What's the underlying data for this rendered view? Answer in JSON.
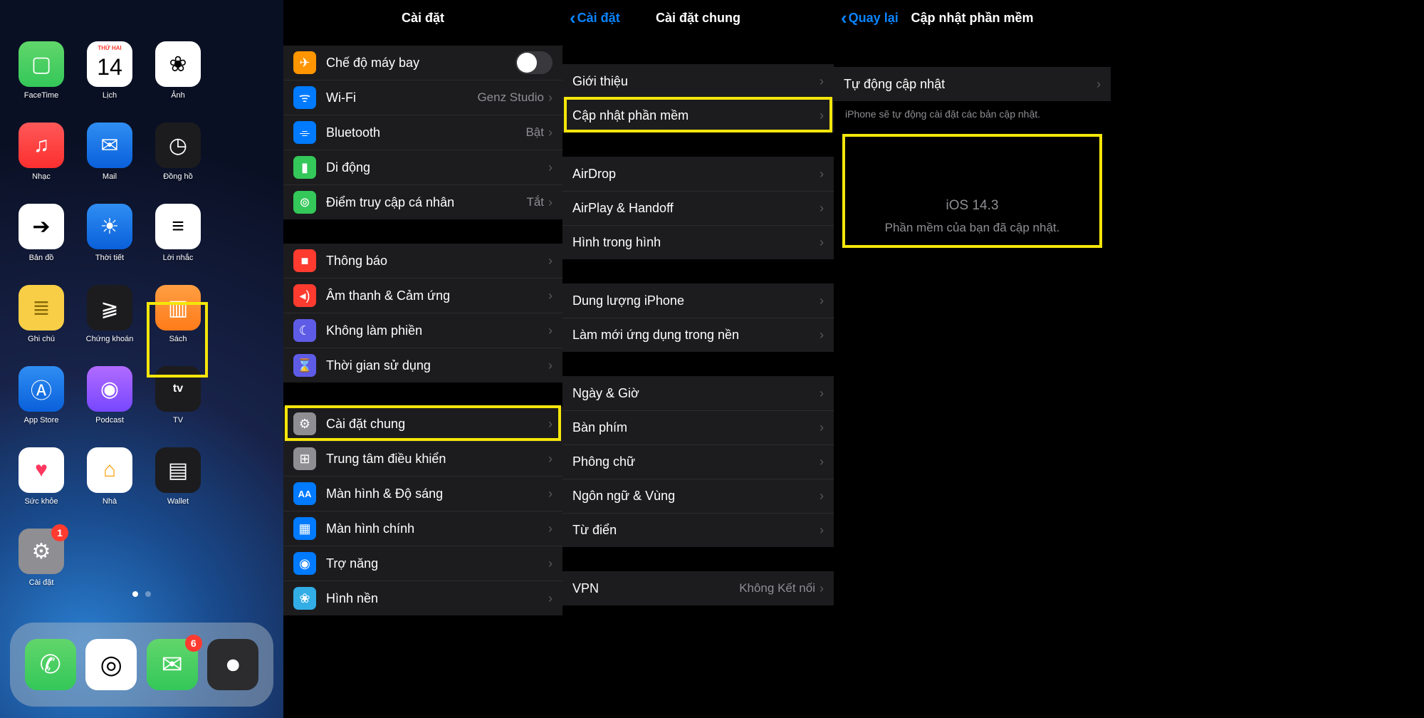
{
  "panel1": {
    "apps": [
      {
        "name": "facetime",
        "label": "FaceTime",
        "cls": "ic-green",
        "glyph": "▢"
      },
      {
        "name": "calendar",
        "label": "Lịch",
        "cls": "ic-white",
        "glyph": "14",
        "top": "THỨ HAI"
      },
      {
        "name": "photos",
        "label": "Ảnh",
        "cls": "ic-white",
        "glyph": "❀"
      },
      {
        "name": "music",
        "label": "Nhạc",
        "cls": "ic-red",
        "glyph": "♫"
      },
      {
        "name": "mail",
        "label": "Mail",
        "cls": "ic-blue",
        "glyph": "✉"
      },
      {
        "name": "clock",
        "label": "Đồng hồ",
        "cls": "ic-dark",
        "glyph": "◷"
      },
      {
        "name": "maps",
        "label": "Bản đồ",
        "cls": "ic-white",
        "glyph": "➔"
      },
      {
        "name": "weather",
        "label": "Thời tiết",
        "cls": "ic-blue",
        "glyph": "☀"
      },
      {
        "name": "reminders",
        "label": "Lời nhắc",
        "cls": "ic-white",
        "glyph": "≡"
      },
      {
        "name": "notes",
        "label": "Ghi chú",
        "cls": "ic-yellow",
        "glyph": "≣"
      },
      {
        "name": "stocks",
        "label": "Chứng khoán",
        "cls": "ic-dark",
        "glyph": "⫺"
      },
      {
        "name": "books",
        "label": "Sách",
        "cls": "ic-orange",
        "glyph": "▥"
      },
      {
        "name": "appstore",
        "label": "App Store",
        "cls": "ic-blue",
        "glyph": "Ⓐ"
      },
      {
        "name": "podcast",
        "label": "Podcast",
        "cls": "ic-purple",
        "glyph": "◉"
      },
      {
        "name": "tv",
        "label": "TV",
        "cls": "ic-dark",
        "glyph": "tv"
      },
      {
        "name": "health",
        "label": "Sức khỏe",
        "cls": "ic-heart",
        "glyph": "♥"
      },
      {
        "name": "home",
        "label": "Nhà",
        "cls": "ic-home",
        "glyph": "⌂"
      },
      {
        "name": "wallet",
        "label": "Wallet",
        "cls": "ic-dark",
        "glyph": "▤"
      },
      {
        "name": "settings",
        "label": "Cài đặt",
        "cls": "ic-bordergrey",
        "glyph": "⚙",
        "badge": "1"
      }
    ],
    "dock": [
      {
        "name": "phone",
        "cls": "ic-green",
        "glyph": "✆"
      },
      {
        "name": "safari",
        "cls": "ic-white",
        "glyph": "◎"
      },
      {
        "name": "messages",
        "cls": "ic-green",
        "glyph": "✉",
        "badge": "6"
      },
      {
        "name": "camera",
        "cls": "ic-grey",
        "glyph": "⏺"
      }
    ]
  },
  "panel2": {
    "title": "Cài đặt",
    "groups": [
      [
        {
          "icon": "airplane",
          "bg": "bg-orange",
          "glyph": "✈",
          "label": "Chế độ máy bay",
          "toggle": true
        },
        {
          "icon": "wifi",
          "bg": "bg-blue",
          "glyph": "ᯤ",
          "label": "Wi-Fi",
          "value": "Genz Studio"
        },
        {
          "icon": "bluetooth",
          "bg": "bg-blue",
          "glyph": "⌯",
          "label": "Bluetooth",
          "value": "Bật"
        },
        {
          "icon": "cellular",
          "bg": "bg-green",
          "glyph": "▮",
          "label": "Di động"
        },
        {
          "icon": "hotspot",
          "bg": "bg-green",
          "glyph": "⊚",
          "label": "Điểm truy cập cá nhân",
          "value": "Tắt"
        }
      ],
      [
        {
          "icon": "notifications",
          "bg": "bg-red",
          "glyph": "■",
          "label": "Thông báo"
        },
        {
          "icon": "sounds",
          "bg": "bg-red",
          "glyph": "◂)",
          "label": "Âm thanh & Cảm ứng"
        },
        {
          "icon": "dnd",
          "bg": "bg-purple",
          "glyph": "☾",
          "label": "Không làm phiền"
        },
        {
          "icon": "screentime",
          "bg": "bg-purple",
          "glyph": "⌛",
          "label": "Thời gian sử dụng"
        }
      ],
      [
        {
          "icon": "general",
          "bg": "bg-grey",
          "glyph": "⚙",
          "label": "Cài đặt chung",
          "highlight": true
        },
        {
          "icon": "control",
          "bg": "bg-grey",
          "glyph": "⊞",
          "label": "Trung tâm điều khiển"
        },
        {
          "icon": "display",
          "bg": "bg-blue",
          "glyph": "AA",
          "label": "Màn hình & Độ sáng"
        },
        {
          "icon": "homescreen",
          "bg": "bg-blue",
          "glyph": "▦",
          "label": "Màn hình chính"
        },
        {
          "icon": "accessibility",
          "bg": "bg-blue",
          "glyph": "◉",
          "label": "Trợ năng"
        },
        {
          "icon": "wallpaper",
          "bg": "bg-cyan",
          "glyph": "❀",
          "label": "Hình nền"
        }
      ]
    ]
  },
  "panel3": {
    "back": "Cài đặt",
    "title": "Cài đặt chung",
    "groups": [
      [
        {
          "label": "Giới thiệu"
        },
        {
          "label": "Cập nhật phần mềm",
          "highlight": true
        }
      ],
      [
        {
          "label": "AirDrop"
        },
        {
          "label": "AirPlay & Handoff"
        },
        {
          "label": "Hình trong hình"
        }
      ],
      [
        {
          "label": "Dung lượng iPhone"
        },
        {
          "label": "Làm mới ứng dụng trong nền"
        }
      ],
      [
        {
          "label": "Ngày & Giờ"
        },
        {
          "label": "Bàn phím"
        },
        {
          "label": "Phông chữ"
        },
        {
          "label": "Ngôn ngữ & Vùng"
        },
        {
          "label": "Từ điển"
        }
      ],
      [
        {
          "label": "VPN",
          "value": "Không Kết nối"
        }
      ]
    ]
  },
  "panel4": {
    "back": "Quay lại",
    "title": "Cập nhật phần mềm",
    "auto_row_label": "Tự động cập nhật",
    "footnote": "iPhone sẽ tự động cài đặt các bản cập nhật.",
    "version": "iOS 14.3",
    "message": "Phần mềm của bạn đã cập nhật."
  }
}
